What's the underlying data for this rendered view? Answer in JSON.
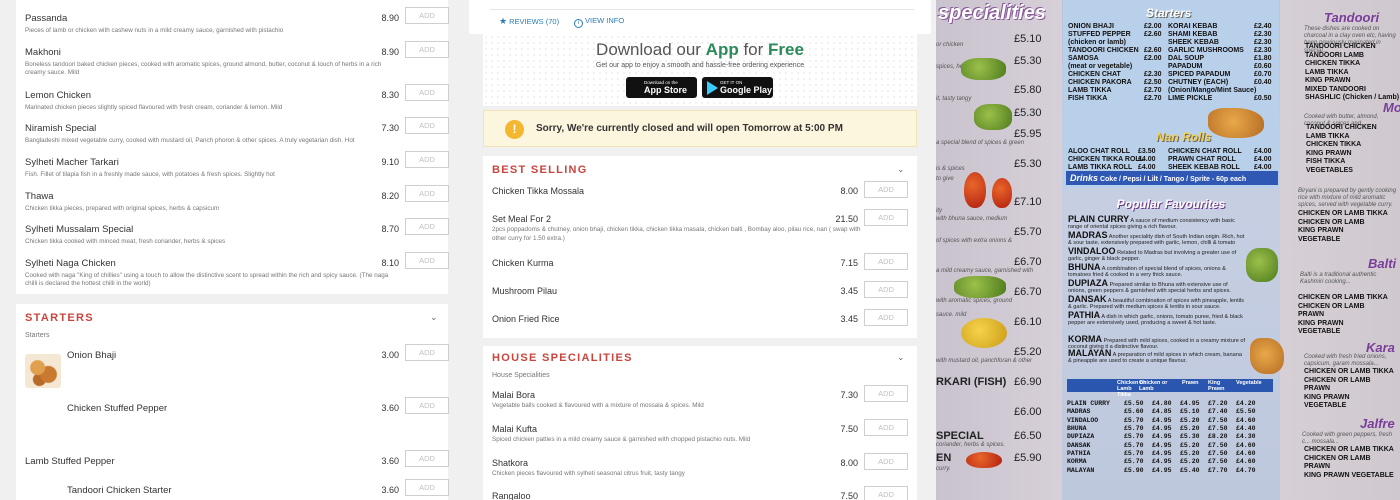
{
  "left_top_items": [
    {
      "name": "Passanda",
      "desc": "Pieces of lamb or chicken with cashew nuts in a mild creamy sauce, garnished with pistachio",
      "price": "8.90",
      "add": "ADD"
    },
    {
      "name": "Makhoni",
      "desc": "Boneless tandoori baked chicken pieces, cooked with aromatic spices, ground almond, butter, coconut & touch of herbs in a rich creamy sauce. Mild",
      "price": "8.90",
      "add": "ADD"
    },
    {
      "name": "Lemon Chicken",
      "desc": "Marinated chicken pieces slightly spiced flavoured with fresh cream, coriander & lemon. Mild",
      "price": "8.30",
      "add": "ADD"
    },
    {
      "name": "Niramish Special",
      "desc": "Bangladeshi mixed vegetable curry, cooked with mustard oil, Panch phoron & other spices. A truly vegetarian dish. Hot",
      "price": "7.30",
      "add": "ADD"
    },
    {
      "name": "Sylheti Macher Tarkari",
      "desc": "Fish. Fillet of tilapia fish in a freshly made sauce, with potatoes & fresh spices. Slightly hot",
      "price": "9.10",
      "add": "ADD"
    },
    {
      "name": "Thawa",
      "desc": "Chicken tikka pieces, prepared with original spices, herbs & capsicum",
      "price": "8.20",
      "add": "ADD"
    },
    {
      "name": "Sylheti Mussalam Special",
      "desc": "Chicken tikka cooked with minced meat, fresh coriander, herbs & spices",
      "price": "8.70",
      "add": "ADD"
    },
    {
      "name": "Sylheti Naga Chicken",
      "desc": "Cooked with naga \"King of chillies\" using a touch to allow the distinctive scent to spread within the rich and spicy sauce. (The naga chilli is declared the hottest chilli in the world)",
      "price": "8.10",
      "add": "ADD"
    }
  ],
  "starters": {
    "title": "STARTERS",
    "subtitle": "Starters",
    "items": [
      {
        "name": "Onion Bhaji",
        "price": "3.00",
        "add": "ADD"
      },
      {
        "name": "Chicken Stuffed Pepper",
        "price": "3.60",
        "add": "ADD"
      },
      {
        "name": "Lamb Stuffed Pepper",
        "price": "3.60",
        "add": "ADD"
      },
      {
        "name": "Tandoori Chicken Starter",
        "price": "3.60",
        "add": "ADD"
      }
    ]
  },
  "info_bar": {
    "reviews": "REVIEWS (70)",
    "view_info": "VIEW INFO"
  },
  "download": {
    "title_pre": "Download our ",
    "title_app": "App",
    "title_mid": " for ",
    "title_free": "Free",
    "subtitle": "Get our app to enjoy a smooth and hassle-free ordering experience",
    "appstore_small": "Download on the",
    "appstore_big": "App Store",
    "google_small": "GET IT ON",
    "google_big": "Google Play"
  },
  "closed_banner": {
    "text": "Sorry, We're currently closed and will open Tomorrow at 5:00 PM"
  },
  "best_selling": {
    "title": "BEST SELLING",
    "items": [
      {
        "name": "Chicken Tikka Mossala",
        "desc": "",
        "price": "8.00",
        "add": "ADD"
      },
      {
        "name": "Set Meal For 2",
        "desc": "2pcs poppadoms & chutney, onion bhaji, chicken tikka, chicken tikka masala, chicken balti , Bombay aloo, pilau rice, nan ( swap with other curry for 1.50 extra.)",
        "price": "21.50",
        "add": "ADD"
      },
      {
        "name": "Chicken Kurma",
        "desc": "",
        "price": "7.15",
        "add": "ADD"
      },
      {
        "name": "Mushroom Pilau",
        "desc": "",
        "price": "3.45",
        "add": "ADD"
      },
      {
        "name": "Onion Fried Rice",
        "desc": "",
        "price": "3.45",
        "add": "ADD"
      }
    ]
  },
  "house_specialities": {
    "title": "HOUSE SPECIALITIES",
    "subtitle": "House Specialities",
    "items": [
      {
        "name": "Malai Bora",
        "desc": "Vegetable balls cooked & flavoured with a mixture of mossala & spices. Mild",
        "price": "7.30",
        "add": "ADD"
      },
      {
        "name": "Malai Kufta",
        "desc": "Spiced chicken patties in a mild creamy sauce & garnished with chopped pistachio nuts. Mild",
        "price": "7.50",
        "add": "ADD"
      },
      {
        "name": "Shatkora",
        "desc": "Chicken pieces flavoured with sylheti seasonal citrus fruit, tasty tangy",
        "price": "8.00",
        "add": "ADD"
      },
      {
        "name": "Rangaloo",
        "desc": "",
        "price": "7.50",
        "add": "ADD"
      }
    ]
  },
  "menu_photo": {
    "header_left": "specialities",
    "left_prices": [
      "£5.10",
      "£5.30",
      "£5.80",
      "£5.30",
      "£5.95",
      "£5.30",
      "£7.10",
      "£5.70",
      "£6.70",
      "£6.70",
      "£6.10",
      "£5.20",
      "£6.90",
      "£6.00",
      "£6.50",
      "£5.90"
    ],
    "left_snippets": [
      "or chicken",
      "spices, herbs",
      "it, tasty tangy",
      "a special blend of spices & green",
      "is & spices",
      "to give",
      "ity",
      "with bhuna sauce, medium",
      "of spices with extra onions &",
      "a mild creamy sauce, garnished with",
      "with aromatic spices, ground",
      "sauce. mild",
      "with mustard oil, panchforan & other",
      "RKARI (FISH)",
      "SPECIAL",
      "EN",
      "curry.",
      "coriander, herbs & spices."
    ],
    "starters_title": "Starters",
    "starters_left": [
      [
        "ONION BHAJI",
        "£2.00"
      ],
      [
        "STUFFED PEPPER",
        "£2.60"
      ],
      [
        "(chicken or lamb)",
        ""
      ],
      [
        "TANDOORI CHICKEN",
        "£2.60"
      ],
      [
        "SAMOSA",
        "£2.00"
      ],
      [
        "(meat or vegetable)",
        ""
      ],
      [
        "CHICKEN CHAT",
        "£2.30"
      ],
      [
        "CHICKEN PAKORA",
        "£2.50"
      ],
      [
        "LAMB TIKKA",
        "£2.70"
      ],
      [
        "FISH TIKKA",
        "£2.70"
      ]
    ],
    "starters_right": [
      [
        "KORAI KEBAB",
        "£2.40"
      ],
      [
        "SHAMI KEBAB",
        "£2.30"
      ],
      [
        "SHEEK KEBAB",
        "£2.30"
      ],
      [
        "GARLIC MUSHROOMS",
        "£2.30"
      ],
      [
        "DAL SOUP",
        "£1.80"
      ],
      [
        "PAPADUM",
        "£0.60"
      ],
      [
        "SPICED PAPADUM",
        "£0.70"
      ],
      [
        "CHUTNEY (EACH)",
        "£0.40"
      ],
      [
        "(Onion/Mango/Mint Sauce)",
        ""
      ],
      [
        "LIME PICKLE",
        "£0.50"
      ]
    ],
    "nan_rolls_title": "Nan Rolls",
    "nan_rolls": [
      [
        "ALOO CHAT ROLL",
        "£3.50",
        "CHICKEN CHAT ROLL",
        "£4.00"
      ],
      [
        "CHICKEN TIKKA ROLL",
        "£4.00",
        "PRAWN CHAT ROLL",
        "£4.00"
      ],
      [
        "LAMB TIKKA ROLL",
        "£4.00",
        "SHEEK KEBAB ROLL",
        "£4.00"
      ]
    ],
    "drinks_title": "Drinks",
    "drinks_text": "Coke / Pepsi / Lilt / Tango / Sprite - 60p each",
    "popular_title": "Popular Favourites",
    "popular": [
      {
        "name": "PLAIN CURRY",
        "desc": "A sauce of medium consistency with basic range of oriental spices giving a rich flavour."
      },
      {
        "name": "MADRAS",
        "desc": "Another speciality dish of South Indian origin. Rich, hot & sour taste, extensively prepared with garlic, lemon, chilli & tomato puree."
      },
      {
        "name": "VINDALOO",
        "desc": "Related to Madras but involving a greater use of garlic, ginger & black pepper."
      },
      {
        "name": "BHUNA",
        "desc": "A combination of special blend of spices, onions & tomatoes fried & cooked in a very thick sauce."
      },
      {
        "name": "DUPIAZA",
        "desc": "Prepared similar to Bhuna with extensive use of onions, green peppers & garnished with special herbs and spices."
      },
      {
        "name": "DANSAK",
        "desc": "A beautiful combination of spices with pineapple, lentils & garlic. Prepared with medium spices & lentils in sour sauce."
      },
      {
        "name": "PATHIA",
        "desc": "A dish in which garlic, onions, tomato puree, fried & black pepper are extensively used, producing a sweet & hot taste."
      },
      {
        "name": "KORMA",
        "desc": "Prepared with mild spices, cooked in a creamy mixture of coconut giving it a distinctive flavour."
      },
      {
        "name": "MALAYAN",
        "desc": "A preparation of mild spices in which cream, banana & pineapple are used to create a unique flavour."
      }
    ],
    "band_headers": [
      "Chicken or Lamb Tikka",
      "Chicken or Lamb",
      "Prawn",
      "King Prawn",
      "Vegetable"
    ],
    "price_rows": [
      [
        "PLAIN CURRY",
        "£5.50",
        "£4.80",
        "£4.95",
        "£7.20",
        "£4.20"
      ],
      [
        "MADRAS",
        "£5.60",
        "£4.85",
        "£5.10",
        "£7.40",
        "£5.50"
      ],
      [
        "VINDALOO",
        "£5.70",
        "£4.95",
        "£5.20",
        "£7.50",
        "£4.60"
      ],
      [
        "BHUNA",
        "£5.70",
        "£4.95",
        "£5.20",
        "£7.50",
        "£4.40"
      ],
      [
        "DUPIAZA",
        "£5.70",
        "£4.95",
        "£5.30",
        "£8.20",
        "£4.30"
      ],
      [
        "DANSAK",
        "£5.70",
        "£4.95",
        "£5.20",
        "£7.50",
        "£4.60"
      ],
      [
        "PATHIA",
        "£5.70",
        "£4.95",
        "£5.20",
        "£7.50",
        "£4.60"
      ],
      [
        "KORMA",
        "£5.70",
        "£4.95",
        "£5.20",
        "£7.50",
        "£4.60"
      ],
      [
        "MALAYAN",
        "£5.90",
        "£4.95",
        "£5.40",
        "£7.70",
        "£4.70"
      ]
    ],
    "right_title_1": "Tandoori",
    "right_intro": "These dishes are cooked on charcoal in a clay oven etc, having been previously marinated in special...",
    "right_list_1": [
      "TANDOORI CHICKEN",
      "TANDOORI LAMB",
      "CHICKEN TIKKA",
      "LAMB TIKKA",
      "KING PRAWN",
      "MIXED TANDOORI",
      "SHASHLIC (Chicken / Lamb)"
    ],
    "right_title_2": "Mo",
    "right_text_2": "Cooked with butter, almond, coconut & spices and...",
    "right_list_2": [
      "TANDOORI CHICKEN",
      "LAMB TIKKA",
      "CHICKEN TIKKA",
      "KING PRAWN",
      "FISH TIKKA",
      "VEGETABLES"
    ],
    "right_text_3": "Biryani is prepared by gently cooking rice with mixture of mild aromatic spices, served with vegetable curry.",
    "right_list_3": [
      "CHICKEN OR LAMB TIKKA",
      "CHICKEN OR LAMB",
      "KING PRAWN",
      "VEGETABLE"
    ],
    "right_title_4": "Balti",
    "right_text_4": "Balti is a traditional authentic Kashmiri cooking...",
    "right_list_4": [
      "CHICKEN OR LAMB TIKKA",
      "CHICKEN OR LAMB",
      "PRAWN",
      "KING PRAWN",
      "VEGETABLE"
    ],
    "right_title_5": "Kara",
    "right_text_5": "Cooked with fresh fried onions, capsicum, garam mossala...",
    "right_list_5": [
      "CHICKEN OR LAMB TIKKA",
      "CHICKEN OR LAMB",
      "PRAWN",
      "KING PRAWN",
      "VEGETABLE"
    ],
    "right_title_6": "Jalfre",
    "right_text_6": "Cooked with green peppers, fresh c... mossala...",
    "right_list_6": [
      "CHICKEN OR LAMB TIKKA",
      "CHICKEN OR LAMB",
      "PRAWN",
      "KING PRAWN VEGETABLE"
    ]
  }
}
